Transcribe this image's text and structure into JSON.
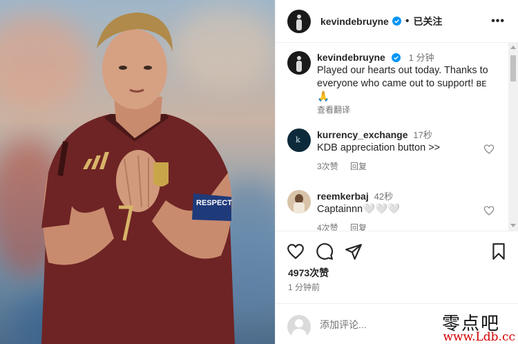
{
  "header": {
    "username": "kevindebruyne",
    "separator": "•",
    "follow_label": "已关注",
    "more_label": "•••"
  },
  "caption": {
    "username": "kevindebruyne",
    "time": "1 分钟",
    "text": "Played our hearts out today. Thanks to everyone who came out to support! ʙᴇ🙏",
    "translate_label": "查看翻译"
  },
  "comments": [
    {
      "username": "kurrency_exchange",
      "time": "17秒",
      "text": "KDB appreciation button >>",
      "likes": "3次赞",
      "reply": "回复"
    },
    {
      "username": "reemkerbaj",
      "time": "42秒",
      "text": "Captainnn🤍🤍🤍",
      "likes": "4次赞",
      "reply": "回复"
    }
  ],
  "actions": {
    "likes_count": "4973次赞",
    "posted_time": "1 分钟前",
    "comment_placeholder": "添加评论..."
  },
  "photo": {
    "armband_text": "RESPECT",
    "jersey_number": "7"
  },
  "watermark": {
    "line1": "零点吧",
    "line2": "www.Ldb.cc"
  },
  "colors": {
    "verified": "#0095f6",
    "jersey": "#7a2a2a",
    "text": "#262626",
    "muted": "#737373"
  },
  "icons": [
    "more-icon",
    "verified-icon",
    "heart-icon",
    "comment-icon",
    "share-icon",
    "bookmark-icon"
  ]
}
